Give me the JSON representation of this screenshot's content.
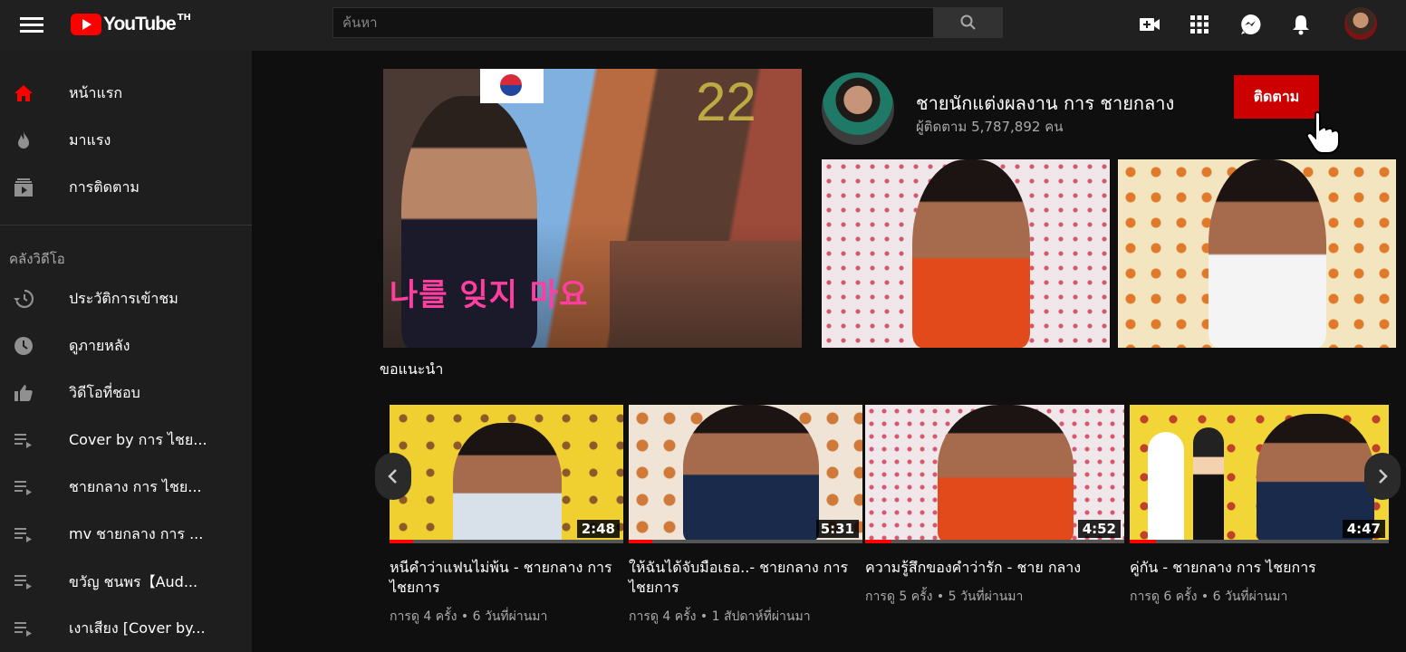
{
  "app": {
    "logo_text": "YouTube",
    "logo_country": "TH",
    "search_placeholder": "ค้นหา",
    "colors": {
      "brand_red": "#ff0000",
      "subscribe_red": "#cc0000",
      "bg": "#0f0f0f",
      "sidebar": "#1e1e1e",
      "topbar": "#202020"
    }
  },
  "topbar_icons": [
    "create-video-icon",
    "apps-grid-icon",
    "messages-icon",
    "notifications-bell-icon",
    "account-avatar"
  ],
  "sidebar": {
    "main": [
      {
        "label": "หน้าแรก",
        "icon": "home-icon",
        "active": true
      },
      {
        "label": "มาแรง",
        "icon": "trending-fire-icon"
      },
      {
        "label": "การติดตาม",
        "icon": "subscriptions-icon"
      }
    ],
    "library_heading": "คลังวิดีโอ",
    "library": [
      {
        "label": "ประวัติการเข้าชม",
        "icon": "history-icon"
      },
      {
        "label": "ดูภายหลัง",
        "icon": "watch-later-clock-icon"
      },
      {
        "label": "วิดีโอที่ชอบ",
        "icon": "thumbs-up-icon"
      },
      {
        "label": "Cover by การ ไชย...",
        "icon": "playlist-icon"
      },
      {
        "label": "ชายกลาง การ ไชย...",
        "icon": "playlist-icon"
      },
      {
        "label": "mv ชายกลาง การ ...",
        "icon": "playlist-icon"
      },
      {
        "label": "ขวัญ ชนพร【Aud...",
        "icon": "playlist-icon"
      },
      {
        "label": "เงาเสียง [Cover by...",
        "icon": "playlist-icon"
      }
    ]
  },
  "featured": {
    "hangul_text": "나를 잊지 마요",
    "number_overlay": "22"
  },
  "channel": {
    "name": "ชายนักแต่งผลงาน การ ชายกลาง",
    "subscribers": "ผู้ติดตาม 5,787,892 คน",
    "subscribe_label": "ติดตาม"
  },
  "section": {
    "title": "ขอแนะนำ"
  },
  "videos": [
    {
      "title": "หนีคำว่าแฟนไม่พ้น - ชายกลาง การ ไชยการ",
      "meta": "การดู 4 ครั้ง • 6 วันที่ผ่านมา",
      "duration": "2:48",
      "progress": 0.1
    },
    {
      "title": "ให้ฉันได้จับมือเธอ..- ชายกลาง การ ไชยการ",
      "meta": "การดู 4 ครั้ง • 1 สัปดาห์ที่ผ่านมา",
      "duration": "5:31",
      "progress": 0.1
    },
    {
      "title": "ความรู้สึกของคำว่ารัก - ชาย กลาง",
      "meta": "การดู 5 ครั้ง • 5 วันที่ผ่านมา",
      "duration": "4:52",
      "progress": 0.1
    },
    {
      "title": "คู่กัน - ชายกลาง การ ไชยการ",
      "meta": "การดู 6 ครั้ง • 6 วันที่ผ่านมา",
      "duration": "4:47",
      "progress": 0.1
    }
  ]
}
